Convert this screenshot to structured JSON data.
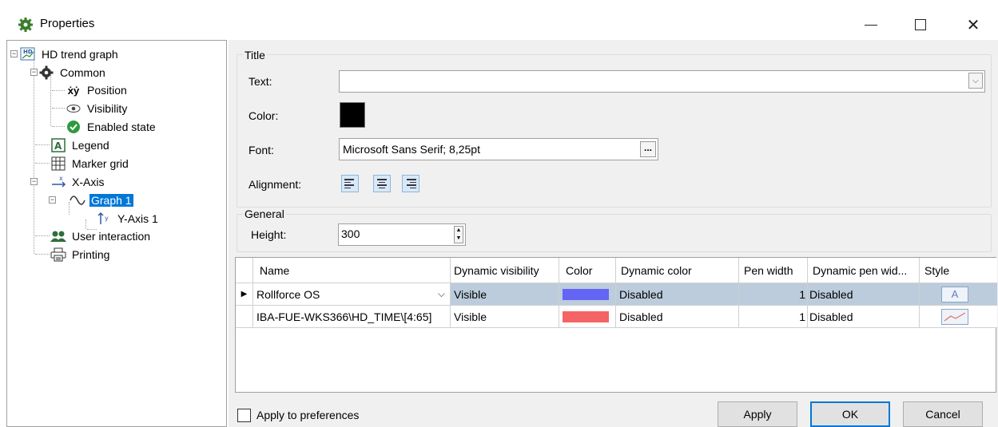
{
  "window": {
    "title": "Properties",
    "icon": "gear-icon",
    "controls": [
      "minimize-icon",
      "maximize-icon",
      "close-icon"
    ]
  },
  "tree": {
    "root": "HD trend graph",
    "common": "Common",
    "position": "Position",
    "visibility": "Visibility",
    "enabled_state": "Enabled state",
    "legend": "Legend",
    "marker_grid": "Marker grid",
    "x_axis": "X-Axis",
    "graph1": "Graph 1",
    "y_axis1": "Y-Axis 1",
    "user_interaction": "User interaction",
    "printing": "Printing"
  },
  "title_group": {
    "label": "Title",
    "text_label": "Text:",
    "text_value": "",
    "color_label": "Color:",
    "color_value": "#000000",
    "font_label": "Font:",
    "font_value": "Microsoft Sans Serif; 8,25pt",
    "font_button": "...",
    "alignment_label": "Alignment:"
  },
  "general_group": {
    "label": "General",
    "height_label": "Height:",
    "height_value": "300"
  },
  "grid": {
    "columns": [
      "Name",
      "Dynamic visibility",
      "Color",
      "Dynamic color",
      "Pen width",
      "Dynamic pen wid...",
      "Style"
    ],
    "rows": [
      {
        "name": "Rollforce OS",
        "visibility": "Visible",
        "color": "#6464f5",
        "dyn_color": "Disabled",
        "pen_width": "1",
        "dyn_pen": "Disabled",
        "style_glyph": "A"
      },
      {
        "name": "IBA-FUE-WKS366\\HD_TIME\\[4:65]",
        "visibility": "Visible",
        "color": "#f56464",
        "dyn_color": "Disabled",
        "pen_width": "1",
        "dyn_pen": "Disabled",
        "style_glyph": ""
      }
    ]
  },
  "footer": {
    "apply_prefs": "Apply to preferences",
    "apply": "Apply",
    "ok": "OK",
    "cancel": "Cancel"
  }
}
